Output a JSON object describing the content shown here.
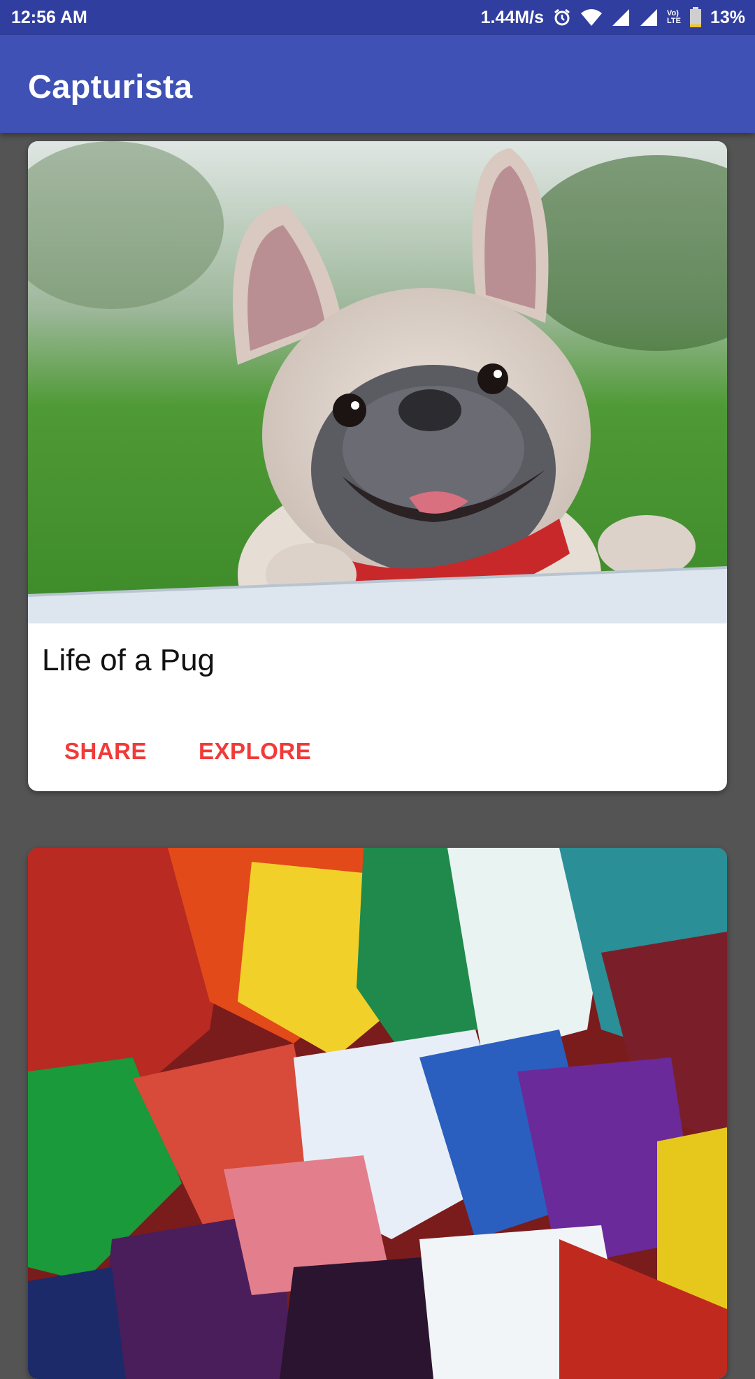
{
  "status_bar": {
    "time": "12:56 AM",
    "network_speed": "1.44M/s",
    "battery": "13%",
    "lte_label_top": "Vo)",
    "lte_label_bottom": "LTE",
    "icons": [
      "alarm-icon",
      "wifi-icon",
      "signal-icon",
      "signal-icon",
      "volte-icon",
      "battery-icon"
    ]
  },
  "app_bar": {
    "title": "Capturista",
    "color": "#3F51B5",
    "status_color": "#303F9F"
  },
  "cards": [
    {
      "image_subject": "pug-photo",
      "title": "Life of a Pug",
      "actions": [
        "SHARE",
        "EXPLORE"
      ],
      "action_color": "#F23A3A"
    },
    {
      "image_subject": "abstract-paint-photo"
    }
  ]
}
